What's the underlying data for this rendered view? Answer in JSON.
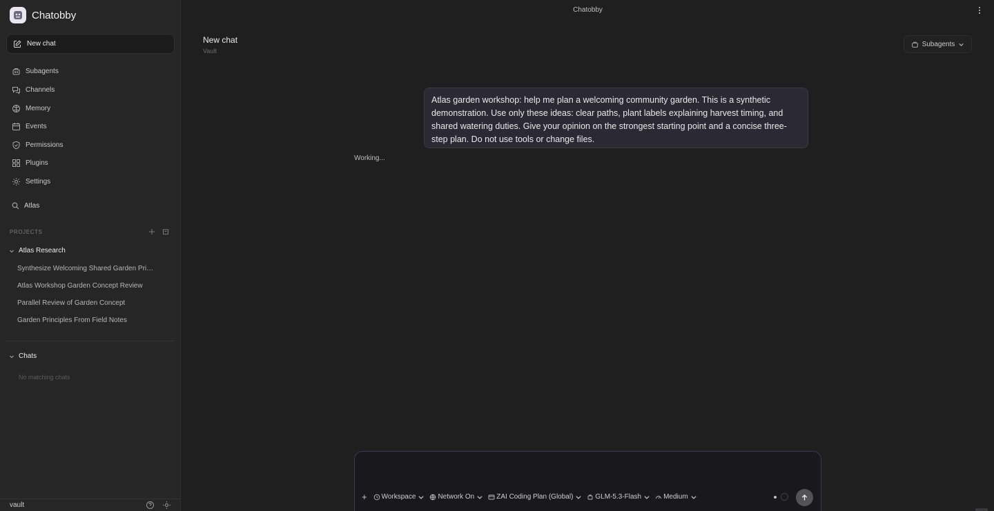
{
  "brand": {
    "name": "Chatobby"
  },
  "sidebar": {
    "new_chat_label": "New chat",
    "nav": [
      {
        "label": "Subagents",
        "icon": "subagents-icon"
      },
      {
        "label": "Channels",
        "icon": "channels-icon"
      },
      {
        "label": "Memory",
        "icon": "memory-icon"
      },
      {
        "label": "Events",
        "icon": "events-icon"
      },
      {
        "label": "Permissions",
        "icon": "shield-icon"
      },
      {
        "label": "Plugins",
        "icon": "plugins-icon"
      },
      {
        "label": "Settings",
        "icon": "gear-icon"
      }
    ],
    "search_value": "Atlas",
    "projects_label": "PROJECTS",
    "project": {
      "name": "Atlas Research",
      "chats": [
        "Synthesize Welcoming Shared Garden Principles",
        "Atlas Workshop Garden Concept Review",
        "Parallel Review of Garden Concept",
        "Garden Principles From Field Notes"
      ]
    },
    "chats_label": "Chats",
    "chats_empty": "No matching chats",
    "footer_user": "vault"
  },
  "main": {
    "window_title": "Chatobby",
    "chat_title": "New chat",
    "chat_subtitle": "Vault",
    "subagents_label": "Subagents",
    "user_message": "Atlas garden workshop: help me plan a welcoming community garden. This is a synthetic demonstration. Use only these ideas: clear paths, plant labels explaining harvest timing, and shared watering duties. Give your opinion on the strongest starting point and a concise three-step plan. Do not use tools or change files.",
    "status": "Working..."
  },
  "composer": {
    "placeholder": "",
    "workspace": "Workspace",
    "network": "Network On",
    "plan": "ZAI Coding Plan (Global)",
    "model": "GLM-5.3-Flash",
    "effort": "Medium"
  }
}
